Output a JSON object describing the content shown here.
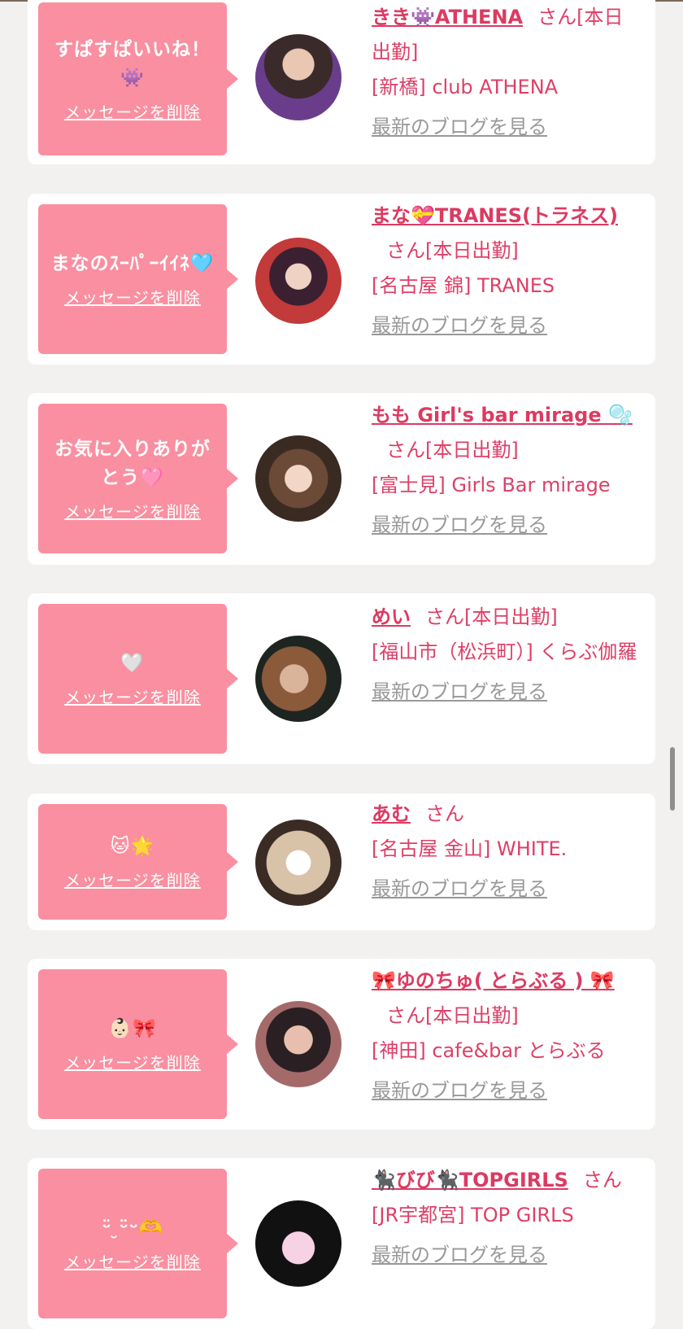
{
  "delete_label": "メッセージを削除",
  "blog_label": "最新のブログを見る",
  "suffix": "さん",
  "items": [
    {
      "message": "すぱすぱいいね！👾",
      "name": "きき👾ATHENA",
      "status": "[本日出勤]",
      "shop": "[新橋] club ATHENA"
    },
    {
      "message": "まなのｽｰﾊﾟｰｲｲﾈ🩵",
      "name": "まな💝TRANES(トラネス)",
      "status": "[本日出勤]",
      "shop": "[名古屋 錦] TRANES"
    },
    {
      "message": "お気に入りありがとう🩷",
      "name": "もも Girl's bar mirage 🫧",
      "status": "[本日出勤]",
      "shop": "[富士見] Girls Bar mirage"
    },
    {
      "message": "🤍",
      "name": "めい",
      "status": "[本日出勤]",
      "shop": "[福山市（松浜町）] くらぶ伽羅"
    },
    {
      "message": "🐱🌟",
      "name": "あむ",
      "status": "",
      "shop": "[名古屋 金山] WHITE."
    },
    {
      "message": "👶🏻🎀",
      "name": "🎀ゆのちゅ( とらぶる ) 🎀",
      "status": "[本日出勤]",
      "shop": "[神田] cafe&bar とらぶる"
    },
    {
      "message": "ᵕ̈ ̮ᵕ̈ᵕ🫶",
      "name": "🐈‍⬛びび🐈‍⬛TOPGIRLS",
      "status": "",
      "shop": "[JR宇都宮] TOP GIRLS"
    }
  ]
}
